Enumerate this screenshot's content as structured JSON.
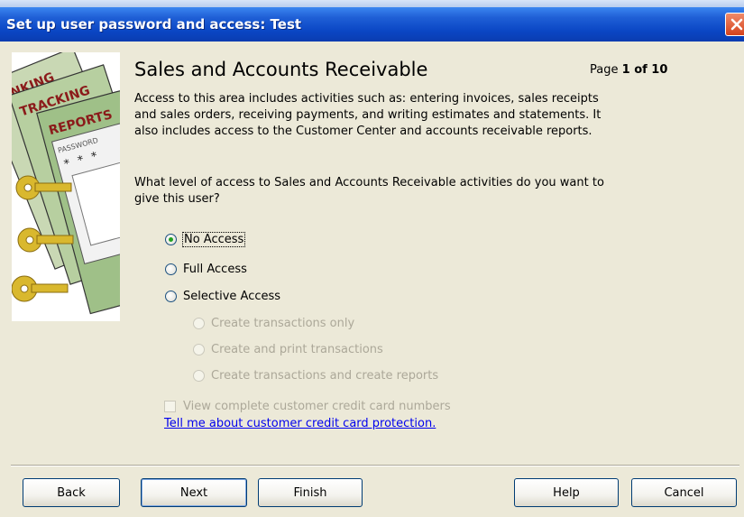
{
  "window": {
    "title": "Set up user password and access: Test"
  },
  "header": {
    "heading": "Sales and Accounts Receivable",
    "page_label": "Page",
    "page_number": "1 of 10"
  },
  "content": {
    "description": "Access to this area includes activities such as: entering invoices, sales receipts and sales orders, receiving payments, and writing estimates and statements. It also includes access to the Customer Center and accounts receivable reports.",
    "question": "What level of access to Sales and Accounts Receivable activities do you want to give this user?",
    "access_options": [
      {
        "label": "No Access",
        "selected": true,
        "enabled": true
      },
      {
        "label": "Full Access",
        "selected": false,
        "enabled": true
      },
      {
        "label": "Selective Access",
        "selected": false,
        "enabled": true
      }
    ],
    "selective_options": [
      {
        "label": "Create transactions only",
        "selected": false,
        "enabled": false
      },
      {
        "label": "Create and print transactions",
        "selected": false,
        "enabled": false
      },
      {
        "label": "Create transactions and create reports",
        "selected": false,
        "enabled": false
      }
    ],
    "credit_card_checkbox": {
      "label": "View complete customer credit card numbers",
      "checked": false,
      "enabled": false
    },
    "help_link": "Tell me about customer credit card protection."
  },
  "art": {
    "labels": [
      "BANKING",
      "TRACKING",
      "REPORTS",
      "PASSWORD"
    ],
    "password_mask": "* * *"
  },
  "buttons": {
    "back": "Back",
    "next": "Next",
    "finish": "Finish",
    "help": "Help",
    "cancel": "Cancel"
  },
  "colors": {
    "title_bar": "#0a46c4",
    "dialog_bg": "#ece9d8",
    "link": "#0000ee",
    "radio_selected": "#21a121"
  }
}
